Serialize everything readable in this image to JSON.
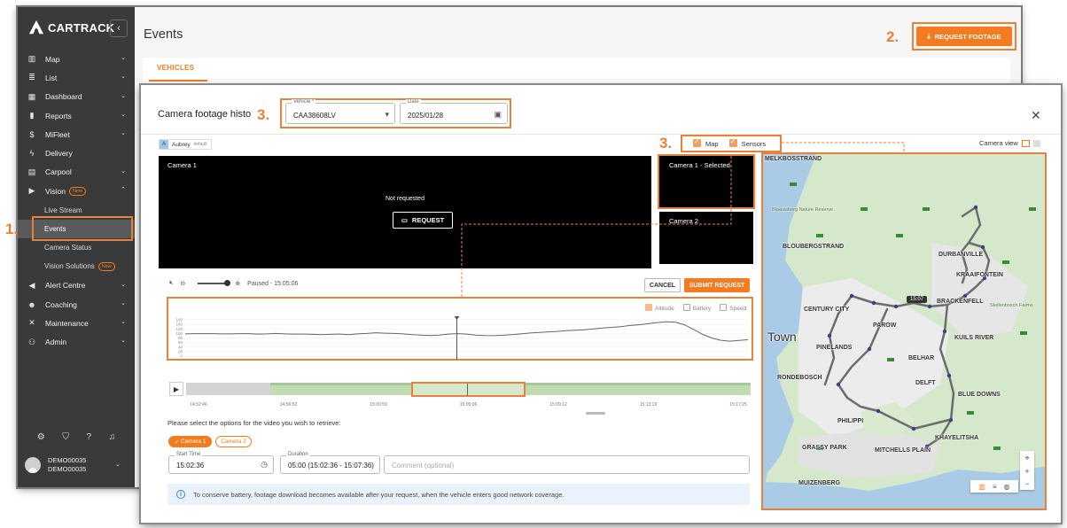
{
  "app": {
    "logo": "CARTRACK",
    "page_title": "Events",
    "request_footage_label": "REQUEST FOOTAGE",
    "tab_vehicles": "VEHICLES"
  },
  "sidebar": {
    "items": [
      {
        "label": "Map",
        "icon": "map-icon",
        "chev": true
      },
      {
        "label": "List",
        "icon": "list-icon",
        "chev": true
      },
      {
        "label": "Dashboard",
        "icon": "dashboard-icon",
        "chev": true
      },
      {
        "label": "Reports",
        "icon": "reports-icon",
        "chev": true
      },
      {
        "label": "MiFleet",
        "icon": "dollar-icon",
        "chev": true
      },
      {
        "label": "Delivery",
        "icon": "bolt-icon",
        "chev": false
      },
      {
        "label": "Carpool",
        "icon": "calendar-icon",
        "chev": true
      },
      {
        "label": "Vision",
        "icon": "camera-icon",
        "chev": true,
        "badge": "New"
      },
      {
        "label": "Live Stream",
        "sub": true
      },
      {
        "label": "Events",
        "sub": true,
        "active": true
      },
      {
        "label": "Camera Status",
        "sub": true
      },
      {
        "label": "Vision Solutions",
        "sub": true,
        "badge": "New"
      },
      {
        "label": "Alert Centre",
        "icon": "alert-icon",
        "chev": true
      },
      {
        "label": "Coaching",
        "icon": "coaching-icon",
        "chev": true
      },
      {
        "label": "Maintenance",
        "icon": "wrench-icon",
        "chev": true
      },
      {
        "label": "Admin",
        "icon": "admin-icon",
        "chev": true
      }
    ],
    "user_name": "DEMO00035",
    "user_account": "DEMO00035"
  },
  "steps": {
    "one": "1.",
    "two": "2.",
    "three_a": "3.",
    "three_b": "3."
  },
  "modal": {
    "title": "Camera footage histo",
    "vehicle_label": "Vehicle *",
    "vehicle_value": "CAA38608LV",
    "date_label": "Date",
    "date_value": "2025/01/28",
    "driver_name": "Aubrey",
    "driver_initial": "A",
    "driver_tag": "default",
    "camera1_label": "Camera 1",
    "not_requested": "Not requested",
    "request_label": "REQUEST",
    "thumb1_label": "Camera 1 - Selected",
    "thumb2_label": "Camera 2",
    "paused_text": "Paused - 15:05:06",
    "cancel_label": "CANCEL",
    "submit_label": "SUBMIT REQUEST",
    "legend": {
      "altitude": "Altitude",
      "battery": "Battery",
      "speed": "Speed"
    },
    "timeline_ticks": [
      "14:52:46",
      "14:56:52",
      "15:00:59",
      "15:05:06",
      "15:09:12",
      "15:13:19",
      "15:17:25"
    ],
    "options_prompt": "Please select the options for the video you wish to retrieve:",
    "chip_camera1": "Camera 1",
    "chip_camera2": "Camera 2",
    "start_time_label": "Start Time",
    "start_time_value": "15:02:36",
    "duration_label": "Duration",
    "duration_value": "05:00 (15:02:36 - 15:07:36)",
    "comment_placeholder": "Comment (optional)",
    "info_text": "To conserve battery, footage download becomes available after your request, when the vehicle enters good network coverage.",
    "map_label": "Map",
    "sensors_label": "Sensors",
    "camera_view_label": "Camera view",
    "map_tooltip": "15:07",
    "map_places": [
      "MELKBOSSTRAND",
      "BLOUBERGSTRAND",
      "DURBANVILLE",
      "KRAAIFONTEIN",
      "CENTURY CITY",
      "PAROW",
      "BRACKENFELL",
      "KUILS RIVER",
      "Town",
      "PINELANDS",
      "BELHAR",
      "RONDEBOSCH",
      "DELFT",
      "BLUE DOWNS",
      "PHILIPPI",
      "KHAYELITSHA",
      "GRASSY PARK",
      "MITCHELLS PLAIN",
      "MUIZENBERG",
      "Stellenbosch Farms",
      "Blaauwberg Nature Reserve"
    ]
  },
  "chart_data": {
    "type": "line",
    "x_ticks": [
      "14:52:46",
      "14:56:52",
      "15:00:59",
      "15:05:06",
      "15:09:12",
      "15:13:19",
      "15:17:25"
    ],
    "y_ticks": [
      0,
      20,
      40,
      60,
      80,
      100,
      120,
      140,
      160
    ],
    "ylim": [
      0,
      160
    ],
    "cursor_x": "15:05:06",
    "series": [
      {
        "name": "Altitude",
        "values": [
          98,
          99,
          99,
          99,
          98,
          98,
          99,
          99,
          97,
          98,
          100,
          98,
          97,
          97,
          96,
          95,
          96,
          97,
          95,
          98,
          100,
          103,
          101,
          100,
          98,
          95,
          93,
          91,
          93,
          97,
          99,
          97,
          93,
          91,
          90,
          92,
          95,
          98,
          102,
          104,
          107,
          109,
          112,
          114,
          116,
          120,
          124,
          127,
          130,
          135,
          138,
          143,
          148,
          151,
          150,
          138,
          118,
          96,
          80,
          70,
          66,
          69,
          72
        ]
      }
    ],
    "legend": [
      "Altitude",
      "Battery",
      "Speed"
    ]
  }
}
